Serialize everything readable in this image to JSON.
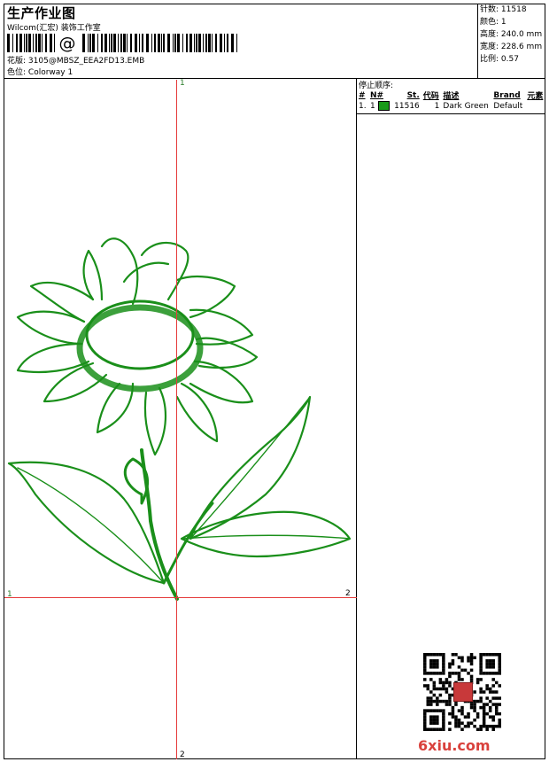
{
  "header": {
    "title": "生产作业图",
    "subtitle": "Wilcom(汇宏) 装饰工作室",
    "barcode_text": "@",
    "design_label": "花版:",
    "design_value": "3105@MBSZ_EEA2FD13.EMB",
    "colorway_label": "色位:",
    "colorway_value": "Colorway 1"
  },
  "stats": {
    "stitches_label": "针数:",
    "stitches": "11518",
    "colors_label": "颜色:",
    "colors": "1",
    "height_label": "高度:",
    "height": "240.0 mm",
    "width_label": "宽度:",
    "width": "228.6 mm",
    "scale_label": "比例:",
    "scale": "0.57"
  },
  "stop_sequence": {
    "title": "停止顺序:",
    "columns": [
      "#",
      "N#",
      "St.",
      "代码",
      "描述",
      "Brand",
      "元素"
    ],
    "rows": [
      {
        "index": "1.",
        "needle": "1",
        "color": "#1a9a1a",
        "stitches": "11516",
        "code": "1",
        "description": "Dark Green",
        "brand": "Default",
        "element": ""
      }
    ]
  },
  "axis_marks": {
    "top": "1",
    "left": "1",
    "right": "2",
    "bottom": "2"
  },
  "design_color": "#1a8f1a",
  "crosshair_color": "#e53a3a",
  "watermark": "6xiu.com"
}
